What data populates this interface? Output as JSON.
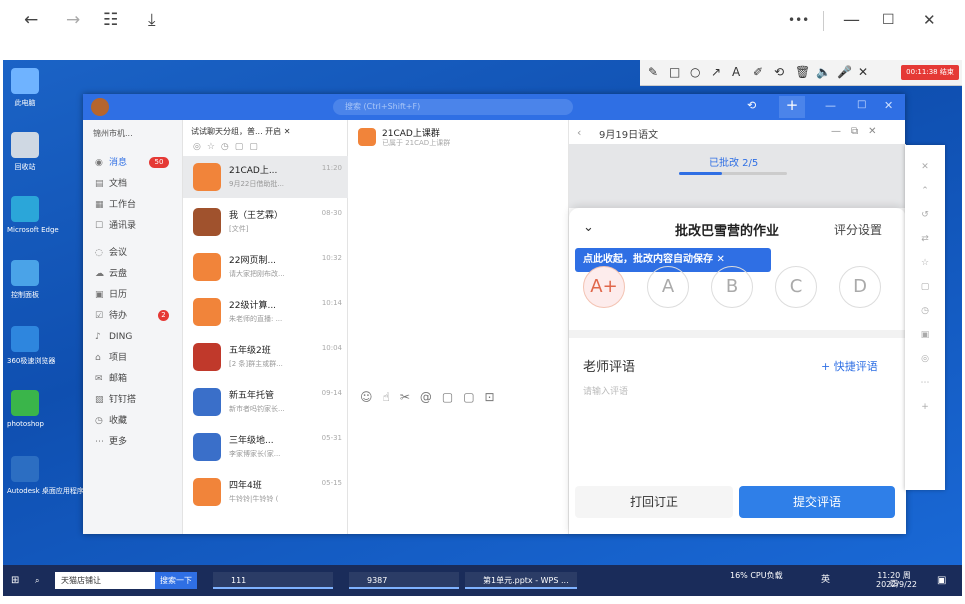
{
  "viewer": {
    "back": "←",
    "forward": "→",
    "grid": "☷",
    "download": "⤓",
    "more": "•••",
    "minimize": "—",
    "maximize": "☐",
    "close": "✕"
  },
  "annotation_bar": {
    "tools": [
      "✎",
      "□",
      "○",
      "↗",
      "A",
      "✐",
      "⟲",
      "🗑",
      "🔈",
      "🎤",
      "✕"
    ],
    "record": "00:11:38 结束"
  },
  "desktop_icons": [
    {
      "label": "此电脑",
      "color": "#6fb3ff"
    },
    {
      "label": "回收站",
      "color": "#cfd8e3"
    },
    {
      "label": "Microsoft Edge",
      "color": "#2ba6d9"
    },
    {
      "label": "控制面板",
      "color": "#4aa3e8"
    },
    {
      "label": "360极速浏览器",
      "color": "#2e86de"
    },
    {
      "label": "photoshop",
      "color": "#3ab54a"
    },
    {
      "label": "Autodesk 桌面应用程序",
      "color": "#2c6ec2"
    }
  ],
  "dingtalk": {
    "search_placeholder": "搜索 (Ctrl+Shift+F)",
    "org": "锦州市机...",
    "nav": [
      {
        "label": "消息",
        "badge": "50",
        "icon": "◉"
      },
      {
        "label": "文档",
        "icon": "▤"
      },
      {
        "label": "工作台",
        "icon": "▦"
      },
      {
        "label": "通讯录",
        "icon": "☐"
      },
      {
        "label": "会议",
        "icon": "◌"
      },
      {
        "label": "云盘",
        "icon": "☁"
      },
      {
        "label": "日历",
        "icon": "▣"
      },
      {
        "label": "待办",
        "badge": "2",
        "icon": "☑"
      },
      {
        "label": "DING",
        "icon": "♪"
      },
      {
        "label": "项目",
        "icon": "⌂"
      },
      {
        "label": "邮箱",
        "icon": "✉"
      },
      {
        "label": "钉钉搭",
        "icon": "▧"
      },
      {
        "label": "收藏",
        "icon": "◷"
      },
      {
        "label": "更多",
        "icon": "⋯"
      }
    ],
    "list_header": "试试聊天分组，普... 开启 ✕",
    "chats": [
      {
        "name": "21CAD上...",
        "preview": "9月22日借助批...",
        "time": "11:20",
        "color": "#f1843a"
      },
      {
        "name": "我（王艺霖）",
        "preview": "[文件]",
        "time": "08-30",
        "color": "#a0522d"
      },
      {
        "name": "22网页制...",
        "preview": "请大家把刚布改...",
        "time": "10:32",
        "color": "#f1843a"
      },
      {
        "name": "22级计算...",
        "preview": "朱老师的直播: ...",
        "time": "10:14",
        "color": "#f1843a"
      },
      {
        "name": "五年级2班",
        "preview": "[2 条]群主或群...",
        "time": "10:04",
        "color": "#c0392b"
      },
      {
        "name": "新五年托管",
        "preview": "新市者吗钓家长...",
        "time": "09-14",
        "color": "#3a6fc9"
      },
      {
        "name": "三年级地...",
        "preview": "李家博家长(家...",
        "time": "05-31",
        "color": "#3a6fc9"
      },
      {
        "name": "四年4班",
        "preview": "牛铃铃|牛铃铃 (",
        "time": "05-15",
        "color": "#f1843a"
      }
    ],
    "convo_title": "21CAD上课群",
    "convo_sub": "已属于 21CAD上课群",
    "hw": {
      "back": "‹",
      "date_title": "9月19日语文",
      "progress": "已批改 2/5",
      "progress_value": 0.4,
      "modal_title": "批改巴雪营的作业",
      "score_settings": "评分设置",
      "tip": "点此收起，批改内容自动保存 ✕",
      "grades": [
        "A+",
        "A",
        "B",
        "C",
        "D"
      ],
      "comment_label": "老师评语",
      "quick_comment": "+ 快捷评语",
      "comment_placeholder": "请输入评语",
      "return_btn": "打回订正",
      "submit_btn": "提交评语"
    }
  },
  "taskbar": {
    "search": "天猫店铺让",
    "search_btn": "搜索一下",
    "items": [
      "111",
      "9387",
      "第1单元.pptx - WPS ..."
    ],
    "cpu": "16% CPU负载",
    "ime": "英",
    "clock_time": "11:20 周四",
    "clock_date": "2022/9/22"
  }
}
